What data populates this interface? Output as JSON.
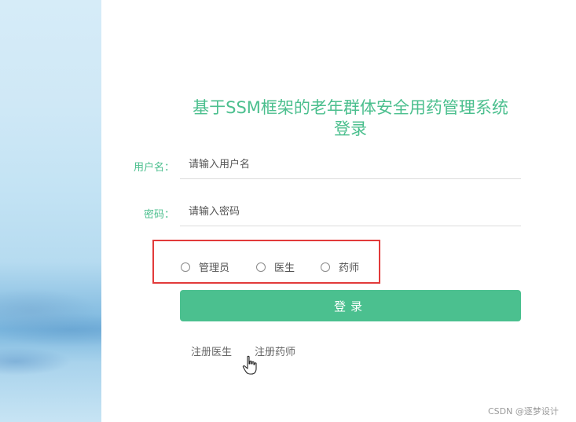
{
  "title": {
    "line1": "基于SSM框架的老年群体安全用药管理系统",
    "line2": "登录"
  },
  "username": {
    "label": "用户名：",
    "placeholder": "请输入用户名",
    "value": ""
  },
  "password": {
    "label": "密码：",
    "placeholder": "请输入密码",
    "value": ""
  },
  "roles": [
    {
      "label": "管理员",
      "selected": false
    },
    {
      "label": "医生",
      "selected": false
    },
    {
      "label": "药师",
      "selected": false
    }
  ],
  "login_button": {
    "label": "登录"
  },
  "links": {
    "register_doctor": "注册医生",
    "register_pharmacist": "注册药师"
  },
  "watermark": "CSDN @逐梦设计",
  "colors": {
    "accent": "#4bc08f",
    "highlight_box": "#e23a3a"
  },
  "icons": {
    "cursor": "hand-pointer-icon"
  }
}
